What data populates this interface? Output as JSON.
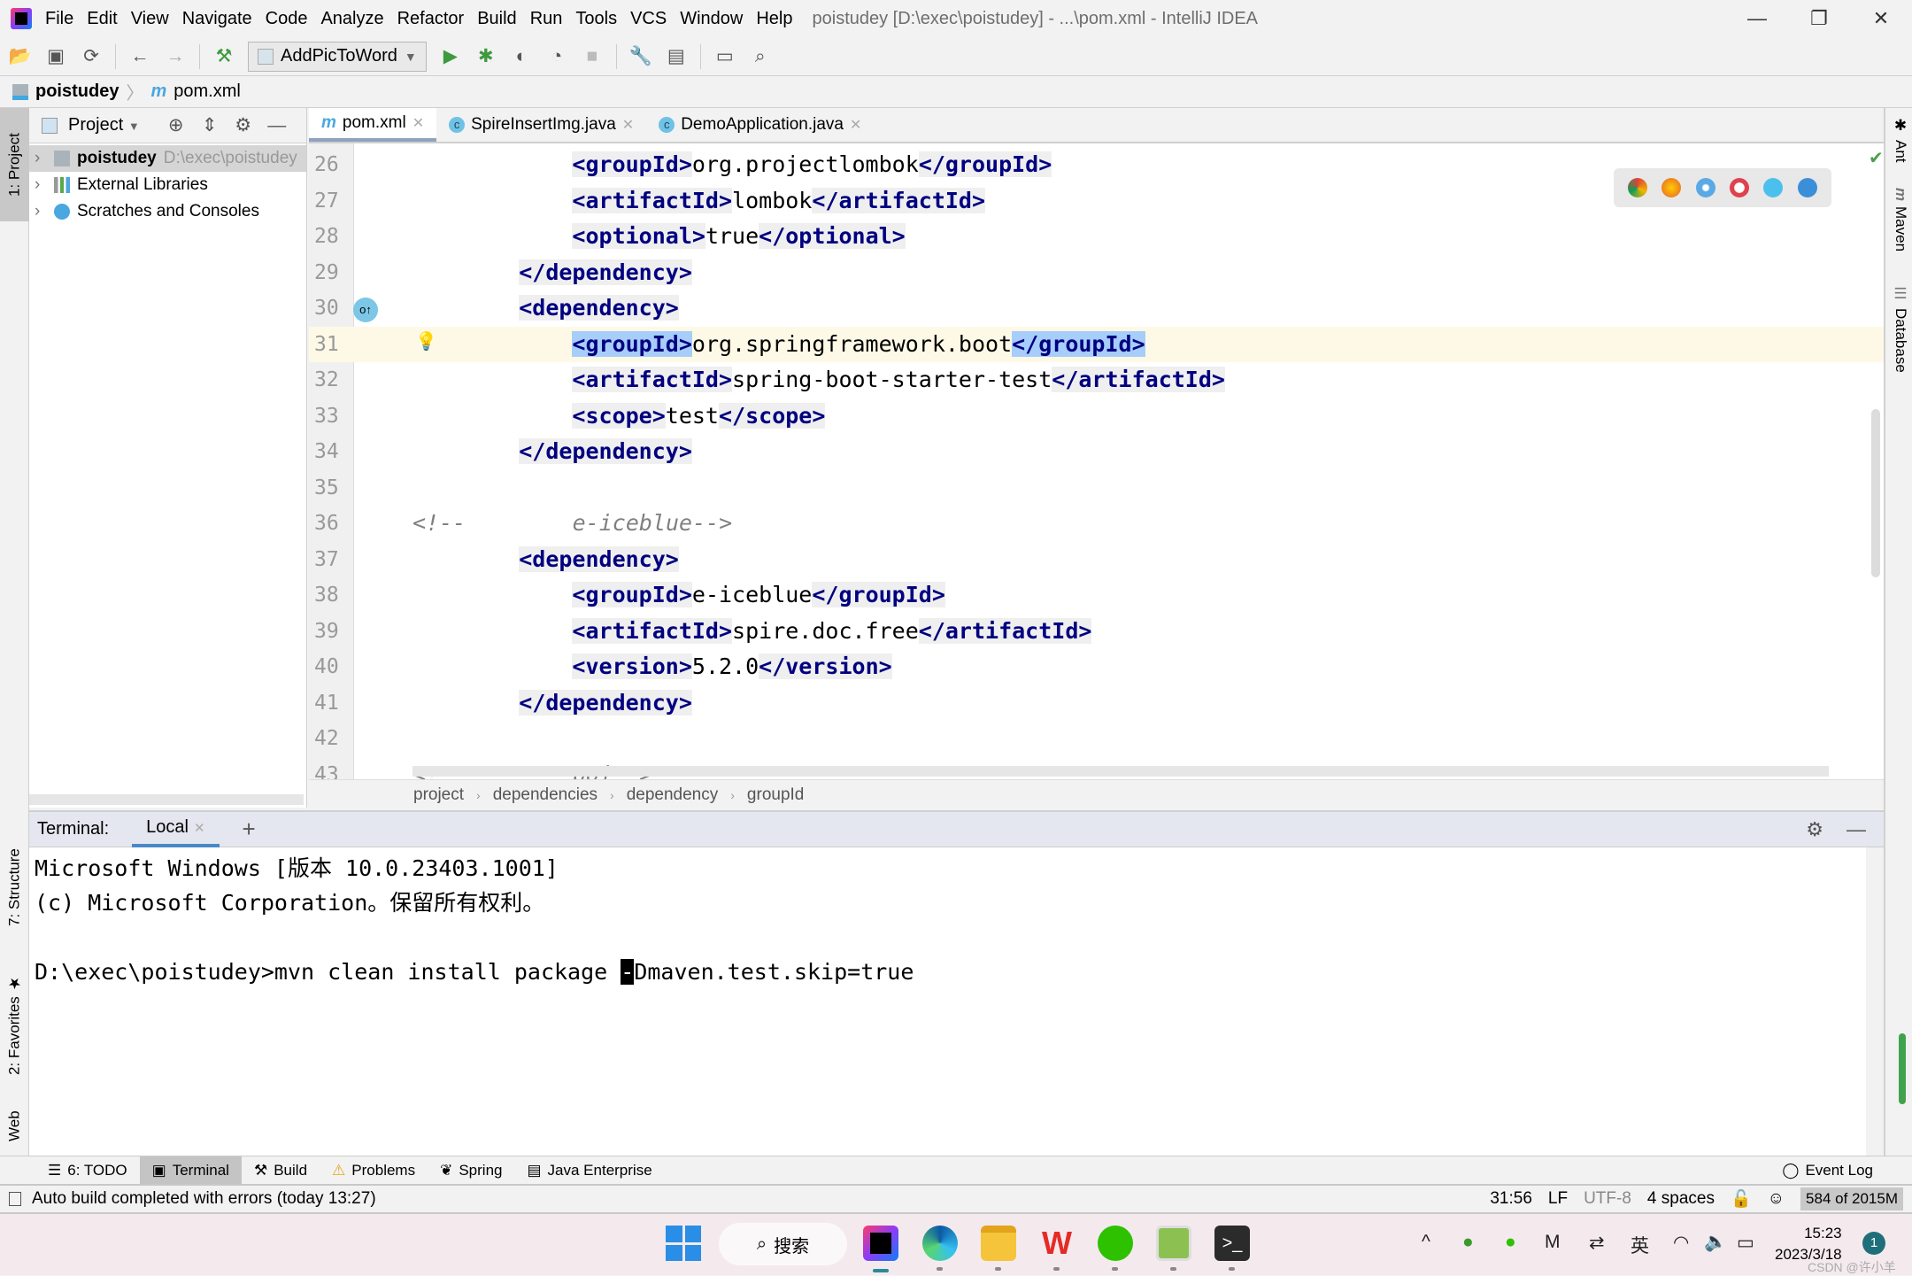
{
  "window": {
    "title": "poistudey [D:\\exec\\poistudey] - ...\\pom.xml - IntelliJ IDEA",
    "menu": [
      "File",
      "Edit",
      "View",
      "Navigate",
      "Code",
      "Analyze",
      "Refactor",
      "Build",
      "Run",
      "Tools",
      "VCS",
      "Window",
      "Help"
    ],
    "controls": {
      "minimize": "—",
      "restore": "❐",
      "close": "✕"
    }
  },
  "toolbar": {
    "run_config": "AddPicToWord"
  },
  "navbar": {
    "project": "poistudey",
    "file": "pom.xml"
  },
  "left_stripe": {
    "project": "1: Project",
    "structure": "7: Structure",
    "favorites": "2: Favorites",
    "web": "Web"
  },
  "right_stripe": {
    "ant": "Ant",
    "maven": "Maven",
    "database": "Database"
  },
  "project_panel": {
    "title": "Project",
    "tree": [
      {
        "label": "poistudey",
        "hint": "D:\\exec\\poistudey",
        "icon": "folder-module-icon",
        "selected": true
      },
      {
        "label": "External Libraries",
        "hint": "",
        "icon": "library-icon",
        "selected": false
      },
      {
        "label": "Scratches and Consoles",
        "hint": "",
        "icon": "scratches-icon",
        "selected": false
      }
    ]
  },
  "editor": {
    "tabs": [
      {
        "label": "pom.xml",
        "icon": "maven-icon",
        "active": true
      },
      {
        "label": "SpireInsertImg.java",
        "icon": "java-class-icon",
        "active": false
      },
      {
        "label": "DemoApplication.java",
        "icon": "spring-class-icon",
        "active": false
      }
    ],
    "current_line": 31,
    "lines": [
      {
        "n": "26",
        "seg": [
          [
            "t",
            "        "
          ],
          [
            "tag",
            "<groupId>"
          ],
          [
            "t",
            "org.projectlombok"
          ],
          [
            "tag",
            "</groupId>"
          ]
        ]
      },
      {
        "n": "27",
        "seg": [
          [
            "t",
            "        "
          ],
          [
            "tag",
            "<artifactId>"
          ],
          [
            "t",
            "lombok"
          ],
          [
            "tag",
            "</artifactId>"
          ]
        ]
      },
      {
        "n": "28",
        "seg": [
          [
            "t",
            "        "
          ],
          [
            "tag",
            "<optional>"
          ],
          [
            "t",
            "true"
          ],
          [
            "tag",
            "</optional>"
          ]
        ]
      },
      {
        "n": "29",
        "seg": [
          [
            "t",
            "    "
          ],
          [
            "tag",
            "</dependency>"
          ]
        ],
        "fold": true
      },
      {
        "n": "30",
        "seg": [
          [
            "t",
            "    "
          ],
          [
            "tag",
            "<dependency>"
          ]
        ],
        "fold": true
      },
      {
        "n": "31",
        "seg": [
          [
            "t",
            "        "
          ],
          [
            "match",
            "<groupId>"
          ],
          [
            "t",
            "org.springframework.boot"
          ],
          [
            "match",
            "</groupId>"
          ]
        ]
      },
      {
        "n": "32",
        "seg": [
          [
            "t",
            "        "
          ],
          [
            "tag",
            "<artifactId>"
          ],
          [
            "t",
            "spring-boot-starter-test"
          ],
          [
            "tag",
            "</artifactId>"
          ]
        ]
      },
      {
        "n": "33",
        "seg": [
          [
            "t",
            "        "
          ],
          [
            "tag",
            "<scope>"
          ],
          [
            "t",
            "test"
          ],
          [
            "tag",
            "</scope>"
          ]
        ]
      },
      {
        "n": "34",
        "seg": [
          [
            "t",
            "    "
          ],
          [
            "tag",
            "</dependency>"
          ]
        ],
        "fold": true
      },
      {
        "n": "35",
        "seg": []
      },
      {
        "n": "36",
        "seg": [
          [
            "cmt",
            "<!--        e-iceblue-->"
          ]
        ],
        "comment": true
      },
      {
        "n": "37",
        "seg": [
          [
            "t",
            "    "
          ],
          [
            "tag",
            "<dependency>"
          ]
        ],
        "fold": true
      },
      {
        "n": "38",
        "seg": [
          [
            "t",
            "        "
          ],
          [
            "tag",
            "<groupId>"
          ],
          [
            "t",
            "e-iceblue"
          ],
          [
            "tag",
            "</groupId>"
          ]
        ]
      },
      {
        "n": "39",
        "seg": [
          [
            "t",
            "        "
          ],
          [
            "tag",
            "<artifactId>"
          ],
          [
            "t",
            "spire.doc.free"
          ],
          [
            "tag",
            "</artifactId>"
          ]
        ]
      },
      {
        "n": "40",
        "seg": [
          [
            "t",
            "        "
          ],
          [
            "tag",
            "<version>"
          ],
          [
            "t",
            "5.2.0"
          ],
          [
            "tag",
            "</version>"
          ]
        ]
      },
      {
        "n": "41",
        "seg": [
          [
            "t",
            "    "
          ],
          [
            "tag",
            "</dependency>"
          ]
        ],
        "fold": true
      },
      {
        "n": "42",
        "seg": []
      },
      {
        "n": "43",
        "seg": [
          [
            "cmt",
            "<!--        poi-->"
          ]
        ],
        "comment": true
      }
    ],
    "breadcrumbs": [
      "project",
      "dependencies",
      "dependency",
      "groupId"
    ],
    "browser_icons": [
      "chrome-icon",
      "firefox-icon",
      "safari-icon",
      "opera-icon",
      "ie-icon",
      "edge-icon"
    ],
    "colors": {
      "tag": "#000080",
      "tag_bg": "#efefef",
      "match_bg": "#a7cdfa",
      "current_line": "#fdf9e6",
      "comment": "#808080"
    }
  },
  "terminal": {
    "label": "Terminal:",
    "tab": "Local",
    "lines": [
      "Microsoft Windows [版本 10.0.23403.1001]",
      "(c) Microsoft Corporation。保留所有权利。",
      ""
    ],
    "prompt": "D:\\exec\\poistudey>mvn clean install package ",
    "cursor_char": "-",
    "after_cursor": "Dmaven.test.skip=true"
  },
  "tool_windows": [
    {
      "label": "6: TODO",
      "icon": "todo-icon",
      "active": false
    },
    {
      "label": "Terminal",
      "icon": "terminal-icon",
      "active": true
    },
    {
      "label": "Build",
      "icon": "build-hammer-icon",
      "active": false
    },
    {
      "label": "Problems",
      "icon": "warning-icon",
      "active": false
    },
    {
      "label": "Spring",
      "icon": "spring-icon",
      "active": false
    },
    {
      "label": "Java Enterprise",
      "icon": "java-enterprise-icon",
      "active": false
    }
  ],
  "event_log": "Event Log",
  "status": {
    "message": "Auto build completed with errors (today 13:27)",
    "position": "31:56",
    "line_sep": "LF",
    "encoding": "UTF-8",
    "indent": "4 spaces",
    "memory": "584 of 2015M"
  },
  "taskbar": {
    "search": "搜索",
    "ime": "英",
    "time": "15:23",
    "date": "2023/3/18",
    "notifications": "1",
    "watermark": "CSDN @许小羊"
  }
}
